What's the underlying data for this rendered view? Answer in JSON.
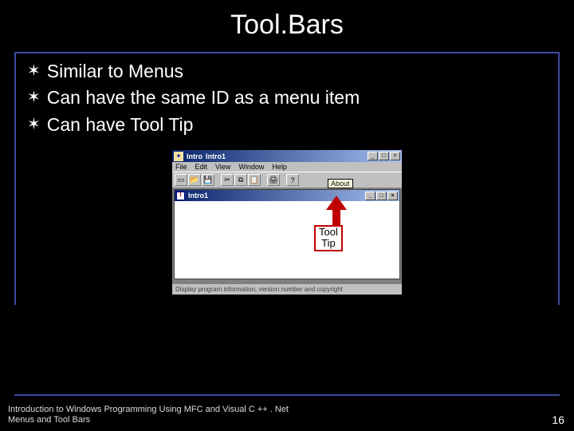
{
  "title": "Tool.Bars",
  "bullets": [
    {
      "text": "Similar to Menus"
    },
    {
      "text": "Can have the same ID as a menu item"
    },
    {
      "text": "Can have Tool Tip"
    }
  ],
  "window": {
    "app_title_prefix": "Intro",
    "app_title": "Intro1",
    "menus": [
      "File",
      "Edit",
      "View",
      "Window",
      "Help"
    ],
    "tooltip_text": "About",
    "doc_title": "Intro1",
    "status_text": "Display program information, version number and copyright"
  },
  "callout": {
    "line1": "Tool",
    "line2": "Tip"
  },
  "footer": {
    "line1": "Introduction to Windows Programming Using MFC and Visual C ++ . Net",
    "line2": "Menus and Tool Bars",
    "page": "16"
  }
}
